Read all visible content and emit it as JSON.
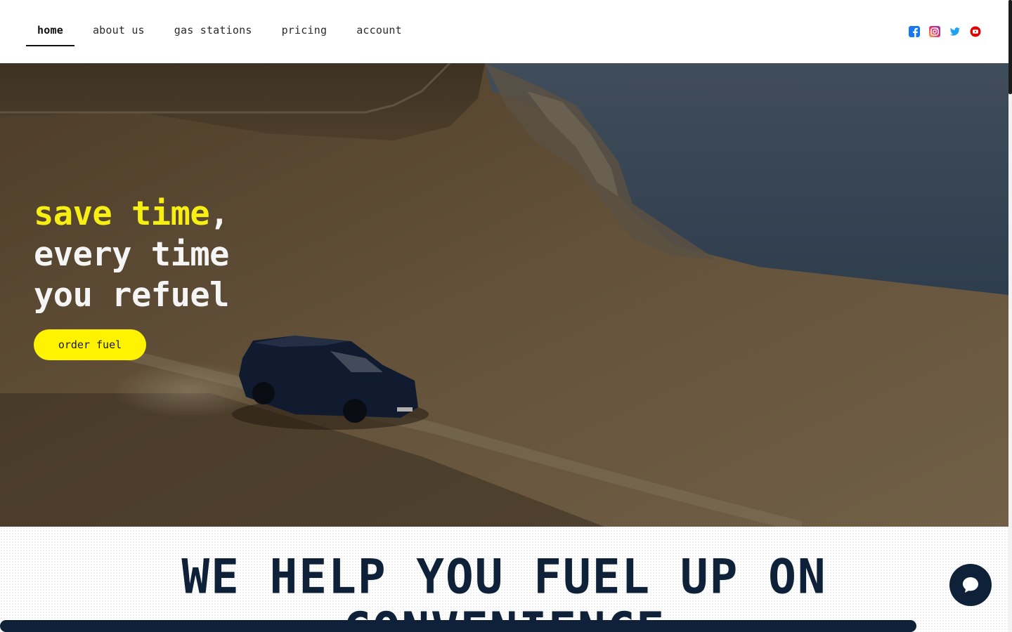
{
  "nav": {
    "items": [
      {
        "label": "home",
        "active": true
      },
      {
        "label": "about us",
        "active": false
      },
      {
        "label": "gas stations",
        "active": false
      },
      {
        "label": "pricing",
        "active": false
      },
      {
        "label": "account",
        "active": false
      }
    ]
  },
  "socials": [
    {
      "icon": "facebook-icon",
      "color": "#1877f2"
    },
    {
      "icon": "instagram-icon",
      "color": "#d6249f"
    },
    {
      "icon": "twitter-icon",
      "color": "#1da1f2"
    },
    {
      "icon": "youtube-icon",
      "color": "#e00000"
    }
  ],
  "hero": {
    "title_highlight": "save time",
    "title_comma": ",",
    "title_line2": "every time",
    "title_line3": "you refuel",
    "cta_label": "order fuel"
  },
  "section": {
    "title_line1": "WE HELP YOU FUEL UP ON",
    "title_line2": "CONVENIENCE"
  },
  "colors": {
    "accent_yellow": "#fff300",
    "navy": "#0e2138"
  }
}
